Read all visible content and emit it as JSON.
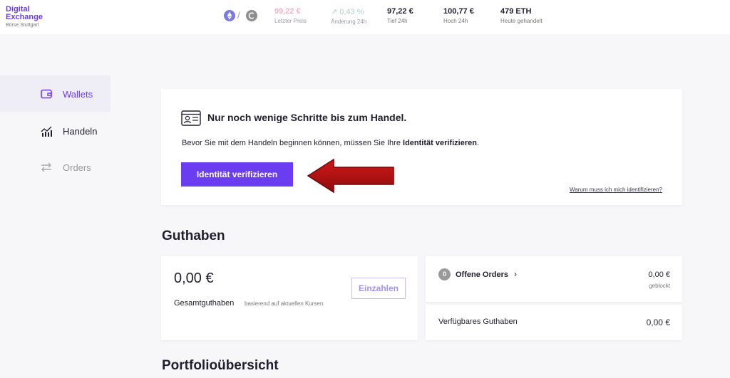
{
  "header": {
    "logo": {
      "line1": "Digital",
      "line2": "Exchange",
      "line3": "Börse Stuttgart"
    },
    "pair": {
      "base_icon": "ethereum-icon",
      "separator": "/",
      "quote_icon": "euro-icon"
    },
    "stats": [
      {
        "value": "99,22 €",
        "label": "Letzter Preis"
      },
      {
        "value": "↗ 0,43 %",
        "label": "Änderung 24h"
      },
      {
        "value": "97,22 €",
        "label": "Tief 24h"
      },
      {
        "value": "100,77 €",
        "label": "Hoch 24h"
      },
      {
        "value": "479 ETH",
        "label": "Heute gehandelt"
      }
    ]
  },
  "sidebar": {
    "items": [
      {
        "label": "Wallets",
        "icon": "wallet-icon",
        "active": true
      },
      {
        "label": "Handeln",
        "icon": "chart-icon",
        "active": false
      },
      {
        "label": "Orders",
        "icon": "swap-arrows-icon",
        "active": false
      }
    ]
  },
  "verification": {
    "title": "Nur noch wenige Schritte bis zum Handel.",
    "desc_prefix": "Bevor Sie mit dem Handeln beginnen können, müssen Sie Ihre ",
    "desc_bold": "Identität verifizieren",
    "desc_suffix": ".",
    "button": "Identität verifizieren",
    "link": "Warum muss ich mich identifizieren?"
  },
  "balance_section": {
    "title": "Guthaben",
    "amount": "0,00 €",
    "label": "Gesamtguthaben",
    "sub": "basierend auf aktuellen Kursen",
    "pay_button": "Einzahlen",
    "open_orders": {
      "count": "0",
      "label": "Offene Orders",
      "chevron": "›",
      "value": "0,00 €",
      "sub": "geblockt"
    },
    "available": {
      "label": "Verfügbares Guthaben",
      "value": "0,00 €"
    }
  },
  "portfolio": {
    "title": "Portfolioübersicht"
  },
  "colors": {
    "accent": "#6a3df0",
    "arrow": "#b31212",
    "background": "#f7f7f9"
  }
}
